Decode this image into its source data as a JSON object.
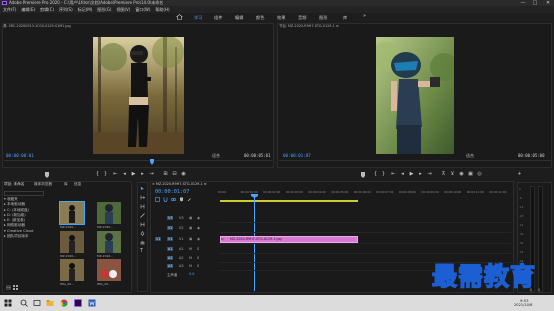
{
  "window": {
    "title": "Adobe Premiere Pro 2020 - C:\\用户\\Lfdsn\\文档\\Adobe\\Premiere Pro\\14.0\\未命名",
    "minimize": "—",
    "maximize": "□",
    "close": "✕"
  },
  "menu": [
    "文件(F)",
    "编辑(E)",
    "剪辑(C)",
    "序列(S)",
    "标记(M)",
    "图形(G)",
    "视图(V)",
    "窗口(W)",
    "帮助(H)"
  ],
  "workspaces": [
    {
      "label": "学习",
      "active": true
    },
    {
      "label": "组件",
      "active": false
    },
    {
      "label": "编辑",
      "active": false
    },
    {
      "label": "颜色",
      "active": false
    },
    {
      "label": "效果",
      "active": false
    },
    {
      "label": "音频",
      "active": false
    },
    {
      "label": "图形",
      "active": false
    },
    {
      "label": "库",
      "active": false
    }
  ],
  "workspace_more": "»",
  "source_monitor": {
    "tab": "源: SRC-20200913-1C00-0129-S1M1.jpg",
    "timecode": "00:00:00:01",
    "fit": "适合",
    "duration": "00:00:05:01"
  },
  "program_monitor": {
    "tab": "节目: MZ-2020-R9H7-STG-0129-1 ≡",
    "timecode": "00:00:01:07",
    "fit": "适合",
    "duration": "00:00:05:00"
  },
  "project": {
    "tabs": [
      "项目: 未命名",
      "媒体浏览器",
      "库",
      "信息"
    ],
    "tree": [
      "▾ 收藏夹",
      "   ▸ 本地驱动器",
      "      ▸ C: (本地磁盘)",
      "      ▸ D: (新加卷)",
      "      ▸ E: (新加卷)",
      "   ▸ 网络驱动器",
      "▾ Creative Cloud",
      "   ▸ 团队项目版本"
    ],
    "thumbs": [
      {
        "label": "MZ-2020...",
        "dur": "5:00"
      },
      {
        "label": "MZ-2020...",
        "dur": "5:00"
      },
      {
        "label": "MZ-2020...",
        "dur": "5:00"
      },
      {
        "label": "MZ-2020...",
        "dur": "5:00"
      },
      {
        "label": "IMG_20...",
        "dur": "5:00"
      },
      {
        "label": "IMG_20...",
        "dur": "5:00"
      }
    ]
  },
  "timeline": {
    "tab": "× MZ-2020-R9H7-STG-0129-1 ≡",
    "timecode": "00:00:01:07",
    "ticks": [
      "00:00",
      "00:00:01:00",
      "00:00:02:00",
      "00:00:03:00",
      "00:00:04:00",
      "00:00:05:00",
      "00:00:06:00",
      "00:00:07:00",
      "00:00:08:00",
      "00:00:09:00",
      "00:00:10:00",
      "00:00:11:00",
      "00:00:12:00"
    ],
    "tracks": [
      "V3",
      "V2",
      "V1",
      "A1",
      "A2",
      "A3",
      "主声道"
    ],
    "master_value": "0.0",
    "clip_label": "MZ-2020-R9H7-STG-0129-1.jpg",
    "fx": "fx"
  },
  "meters": {
    "labels": [
      "0",
      "-6",
      "-12",
      "-18",
      "-24",
      "-30",
      "-36",
      "-42",
      "-48",
      "-54",
      "dB"
    ],
    "solo": "S",
    "solo2": "S"
  },
  "watermark": "最需教育",
  "taskbar": {
    "time": "9:53",
    "date": "2021/10/8"
  },
  "colors": {
    "accent": "#4aa3ff",
    "clip": "#d77ad1",
    "workarea": "#cccc33"
  }
}
